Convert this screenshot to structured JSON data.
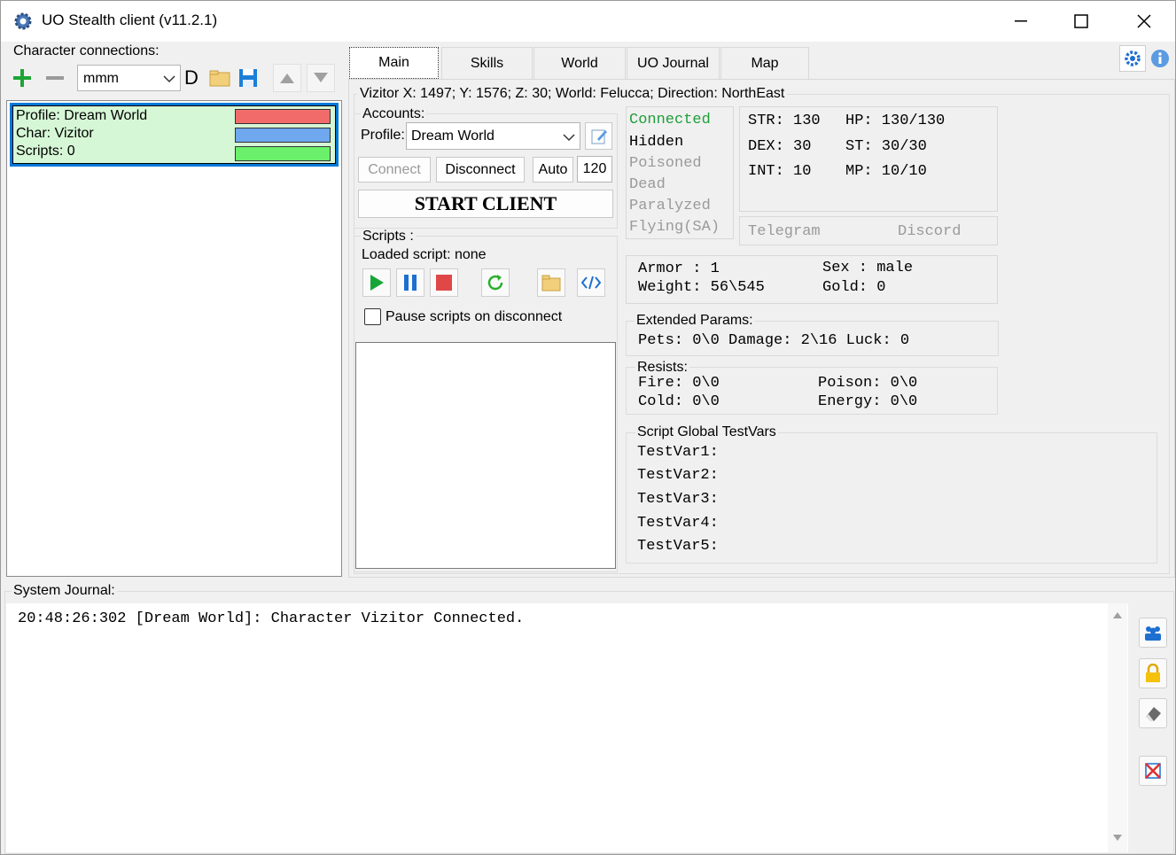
{
  "window": {
    "title": "UO Stealth client (v11.2.1)",
    "minimize": "—",
    "maximize": "☐",
    "close": "✕"
  },
  "connections": {
    "title": "Character connections:",
    "profile_select": "mmm",
    "d_label": "D",
    "entry": {
      "profile": "Profile: Dream World",
      "char": "Char: Vizitor",
      "scripts": "Scripts: 0",
      "colors": [
        "#f26b6b",
        "#6fa8ef",
        "#6af06a"
      ]
    }
  },
  "tabs": [
    "Main",
    "Skills",
    "World",
    "UO Journal",
    "Map"
  ],
  "status_line": "Vizitor  X: 1497;  Y: 1576;  Z: 30; World: Felucca;  Direction: NorthEast",
  "accounts": {
    "title": "Accounts:",
    "profile_label": "Profile:",
    "profile_value": "Dream World",
    "connect": "Connect",
    "disconnect": "Disconnect",
    "auto": "Auto",
    "auto_value": "120",
    "start": "START  CLIENT"
  },
  "scripts": {
    "title": "Scripts :",
    "loaded": "Loaded script:  none",
    "pause_label": "Pause scripts on disconnect"
  },
  "flags": {
    "connected": "Connected",
    "hidden": "Hidden",
    "poisoned": "Poisoned",
    "dead": "Dead",
    "paralyzed": "Paralyzed",
    "flying": "Flying(SA)"
  },
  "stats": {
    "str": "STR: 130",
    "dex": "DEX: 30",
    "int": "INT: 10",
    "hp": "HP:  130/130",
    "st": "ST:  30/30",
    "mp": "MP:  10/10"
  },
  "social": {
    "telegram": "Telegram",
    "discord": "Discord"
  },
  "char_info": {
    "armor": "Armor : 1",
    "weight": "Weight: 56\\545",
    "sex": "Sex : male",
    "gold": "Gold: 0"
  },
  "extended": {
    "title": "Extended Params:",
    "line": "Pets: 0\\0 Damage: 2\\16   Luck: 0"
  },
  "resists": {
    "title": "Resists:",
    "fire": "Fire: 0\\0",
    "cold": "Cold: 0\\0",
    "poison": "Poison: 0\\0",
    "energy": "Energy: 0\\0"
  },
  "testvars": {
    "title": "Script Global TestVars",
    "items": [
      "TestVar1:",
      "TestVar2:",
      "TestVar3:",
      "TestVar4:",
      "TestVar5:"
    ]
  },
  "journal": {
    "title": "System Journal:",
    "lines": [
      "20:48:26:302 [Dream World]: Character Vizitor Connected."
    ]
  }
}
